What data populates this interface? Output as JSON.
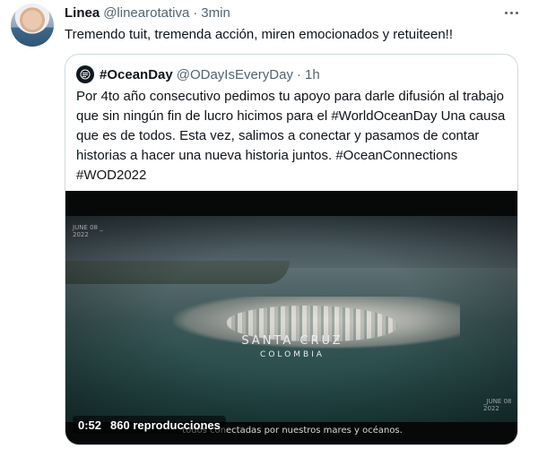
{
  "tweet": {
    "display_name": "Linea",
    "handle": "@linearotativa",
    "separator": "·",
    "time": "3min",
    "text": "Tremendo tuit, tremenda acción, miren emocionados y retuiteen!!"
  },
  "quoted": {
    "display_name": "#OceanDay",
    "handle": "@ODayIsEveryDay",
    "separator": "·",
    "time": "1h",
    "lines": [
      "Por 4to año consecutivo pedimos tu apoyo para darle difusión al trabajo",
      "que sin ningún fin de lucro hicimos para el #WorldOceanDay Una causa",
      "que es de todos. Esta vez, salimos a conectar y pasamos de contar",
      "historias a hacer una nueva historia juntos. #OceanConnections",
      "#WOD2022"
    ],
    "video": {
      "stamp_top_left": [
        "JUNE 08 _",
        "2022"
      ],
      "stamp_bottom_right": [
        "_JUNE 08",
        "2022"
      ],
      "location": "SANTA CRUZ",
      "country": "COLOMBIA",
      "subtitle": "todos conectadas por nuestros mares y océanos.",
      "duration": "0:52",
      "views": "860 reproducciones"
    }
  },
  "icons": {
    "more": "more-horizontal-icon",
    "quoted_avatar": "ocean-day-logo-icon"
  },
  "colors": {
    "text": "#0f1419",
    "secondary": "#536471",
    "border": "#cfd9de"
  }
}
